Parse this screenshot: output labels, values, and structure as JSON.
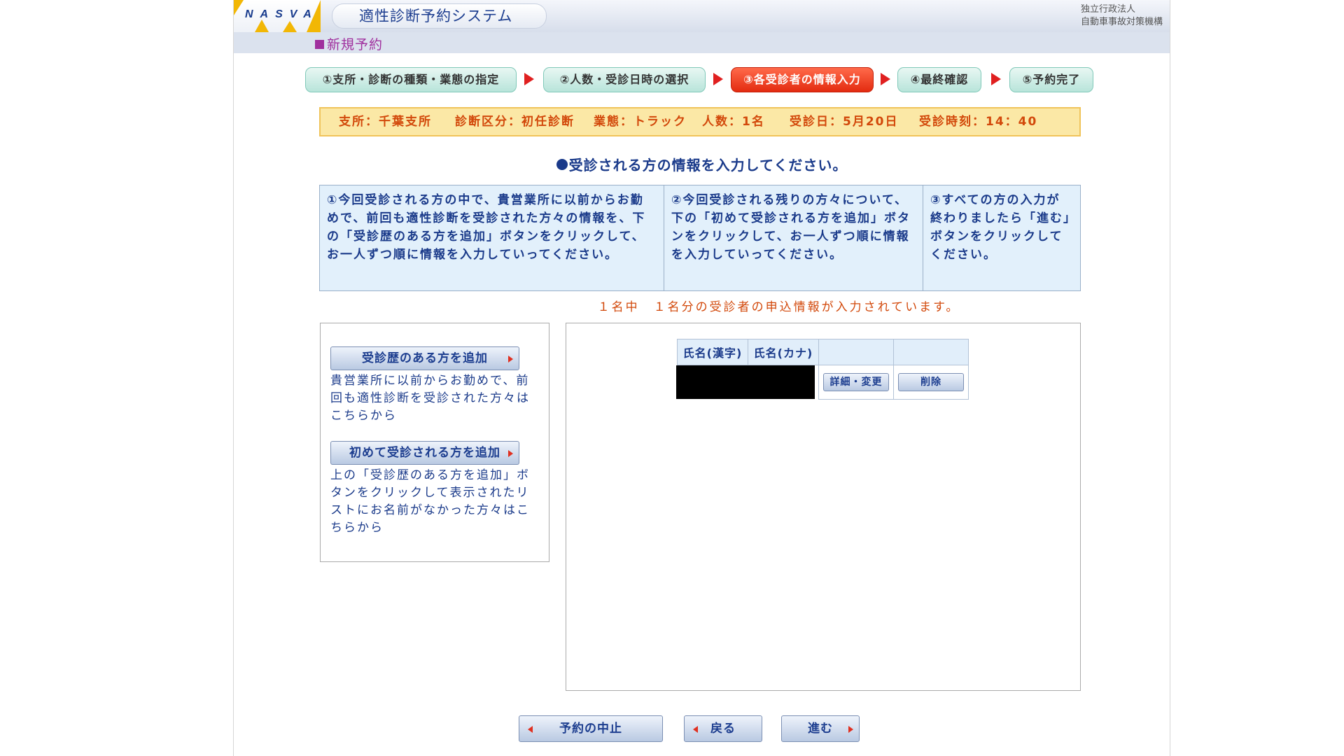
{
  "header": {
    "logo_text": "NASVA",
    "system_title": "適性診断予約システム",
    "org_line1": "独立行政法人",
    "org_line2": "自動車事故対策機構"
  },
  "section_title": "新規予約",
  "steps": [
    {
      "label": "①支所・診断の種類・業態の指定",
      "active": false
    },
    {
      "label": "②人数・受診日時の選択",
      "active": false
    },
    {
      "label": "③各受診者の情報入力",
      "active": true
    },
    {
      "label": "④最終確認",
      "active": false
    },
    {
      "label": "⑤予約完了",
      "active": false
    }
  ],
  "summary": {
    "branch": "支所：千葉支所",
    "category": "診断区分：初任診断",
    "business": "業態：トラック",
    "people": "人数：1名",
    "date": "受診日：5月20日",
    "time": "受診時刻：14：40"
  },
  "instruction": "受診される方の情報を入力してください。",
  "guide": [
    "①今回受診される方の中で、貴営業所に以前からお勤めで、前回も適性診断を受診された方々の情報を、下の「受診歴のある方を追加」ボタンをクリックして、お一人ずつ順に情報を入力していってください。",
    "②今回受診される残りの方々について、下の「初めて受診される方を追加」ボタンをクリックして、お一人ずつ順に情報を入力していってください。",
    "③すべての方の入力が終わりましたら「進む」ボタンをクリックしてください。"
  ],
  "count_line": "１名中　１名分の受診者の申込情報が入力されています。",
  "left_panel": {
    "add_existing_label": "受診歴のある方を追加",
    "add_existing_desc": "貴営業所に以前からお勤めで、前回も適性診断を受診された方々はこちらから",
    "add_new_label": "初めて受診される方を追加",
    "add_new_desc": "上の「受診歴のある方を追加」ボタンをクリックして表示されたリストにお名前がなかった方々はこちらから"
  },
  "table": {
    "headers": [
      "氏名(漢字)",
      "氏名(カナ)",
      "",
      ""
    ],
    "rows": [
      {
        "kanji": "",
        "kana": "",
        "edit_label": "詳細・変更",
        "delete_label": "削除"
      }
    ]
  },
  "nav": {
    "cancel_label": "予約の中止",
    "back_label": "戻る",
    "next_label": "進む"
  },
  "colors": {
    "brand_blue": "#1a3a8a",
    "active_step": "#e32b10",
    "summary_bg": "#fbe8a6",
    "summary_text": "#d2480a",
    "section_title": "#a0309e"
  }
}
